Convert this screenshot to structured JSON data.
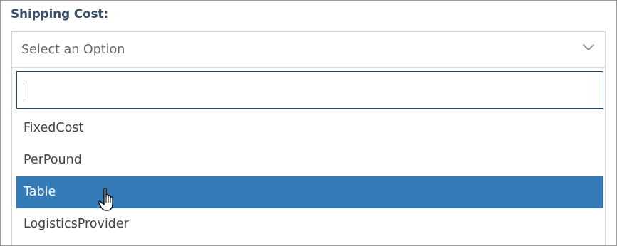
{
  "field": {
    "label": "Shipping Cost:",
    "select_value": "Select an Option"
  },
  "dropdown": {
    "search_value": "",
    "options": [
      {
        "label": "FixedCost",
        "selected": false
      },
      {
        "label": "PerPound",
        "selected": false
      },
      {
        "label": "Table",
        "selected": true
      },
      {
        "label": "LogisticsProvider",
        "selected": false
      }
    ]
  },
  "icons": {
    "chevron": "chevron-down-icon",
    "cursor": "hand-pointer-cursor-icon"
  },
  "colors": {
    "label": "#3a506b",
    "highlight": "#337ab7",
    "search_border": "#1f4b70"
  }
}
